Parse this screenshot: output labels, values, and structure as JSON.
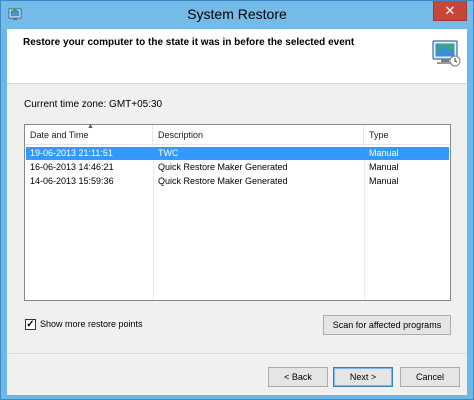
{
  "window": {
    "title": "System Restore",
    "close_glyph": "✕",
    "icons": {
      "app": "system-restore-icon",
      "header": "system-restore-icon"
    }
  },
  "header": {
    "text": "Restore your computer to the state it was in before the selected event"
  },
  "timezone": {
    "label": "Current time zone: GMT+05:30"
  },
  "list": {
    "columns": [
      {
        "label": "Date and Time"
      },
      {
        "label": "Description"
      },
      {
        "label": "Type"
      }
    ],
    "sort_indicator": "▲",
    "rows": [
      {
        "date": "19-06-2013 21:11:51",
        "description": "TWC",
        "type": "Manual",
        "selected": true
      },
      {
        "date": "16-06-2013 14:46:21",
        "description": "Quick Restore Maker Generated",
        "type": "Manual",
        "selected": false
      },
      {
        "date": "14-06-2013 15:59:36",
        "description": "Quick Restore Maker Generated",
        "type": "Manual",
        "selected": false
      }
    ]
  },
  "options": {
    "show_more_label": "Show more restore points",
    "show_more_checked": true,
    "check_glyph": "✓",
    "scan_button": "Scan for affected programs"
  },
  "footer": {
    "back_button": "< Back",
    "next_button": "Next >",
    "cancel_button": "Cancel"
  },
  "colors": {
    "selection": "#3399ff",
    "titlebar": "#74bbea",
    "close": "#c7463a"
  }
}
